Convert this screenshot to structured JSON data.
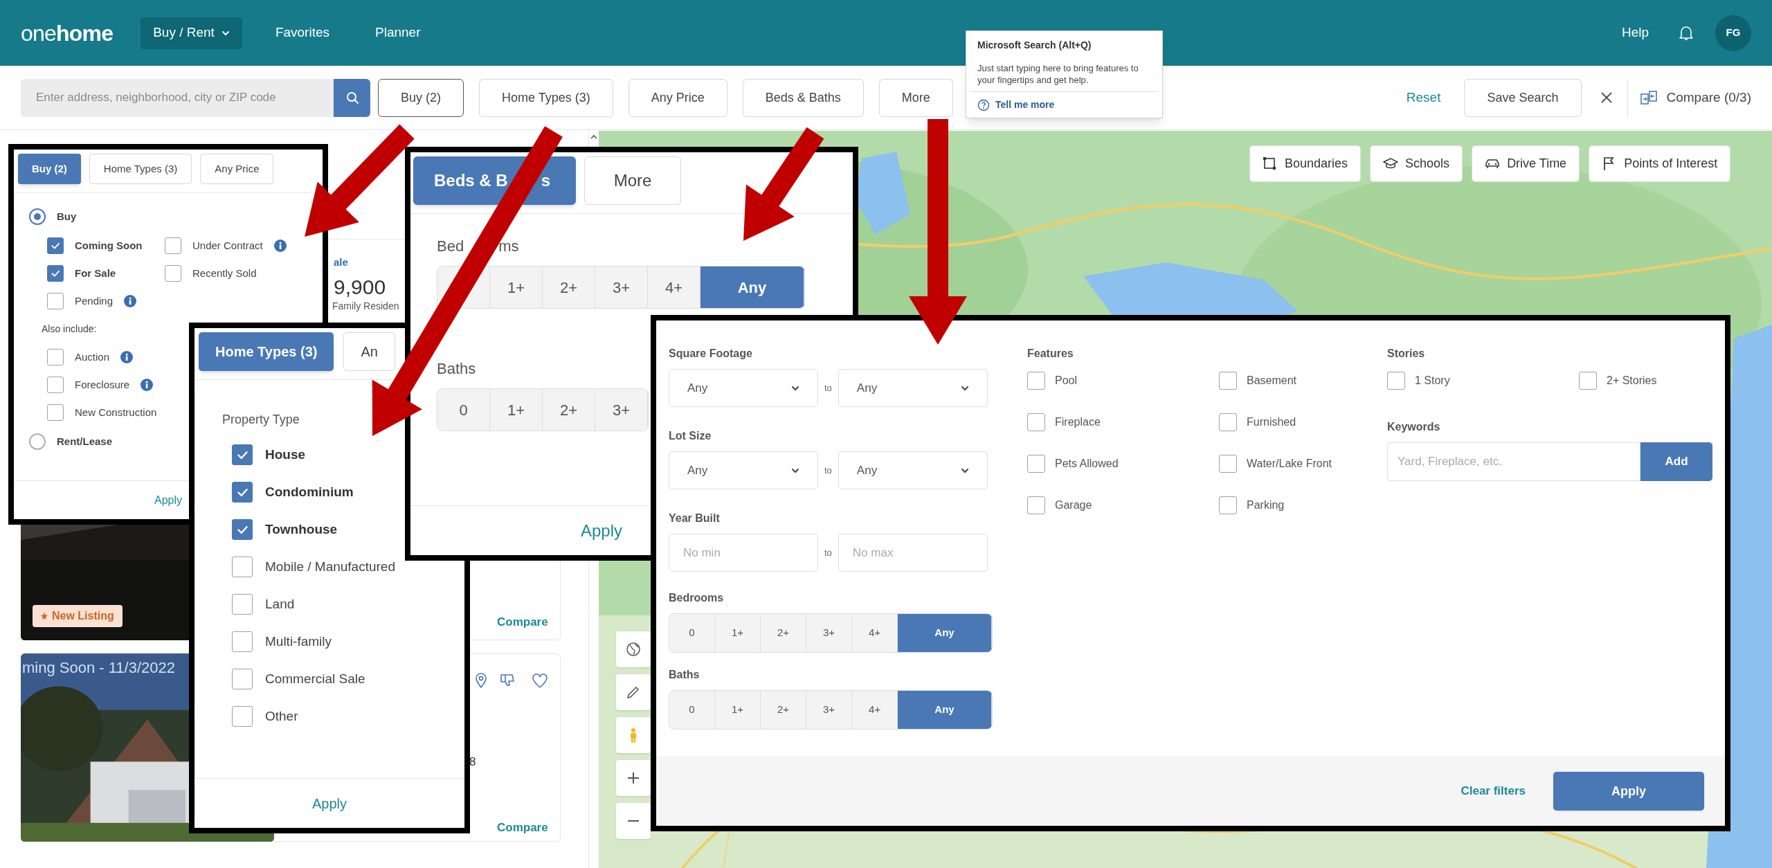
{
  "header": {
    "logo": "one**home**",
    "nav": [
      {
        "label": "Buy / Rent",
        "selected": true
      },
      {
        "label": "Favorites",
        "selected": false
      },
      {
        "label": "Planner",
        "selected": false
      }
    ],
    "help": "Help",
    "avatar": "FG"
  },
  "toolbar": {
    "search": {
      "placeholder": "Enter address, neighborhood, city or ZIP code"
    },
    "filters": [
      {
        "label": "Buy (2)",
        "selected": true
      },
      {
        "label": "Home Types (3)",
        "selected": false
      },
      {
        "label": "Any Price",
        "selected": false
      },
      {
        "label": "Beds & Baths",
        "selected": false
      },
      {
        "label": "More",
        "selected": false
      }
    ],
    "reset": "Reset",
    "save_search": "Save Search",
    "compare": "Compare (0/3)"
  },
  "tooltip": {
    "title": "Microsoft Search (Alt+Q)",
    "body": "Just start typing here to bring features to your fingertips and get help.",
    "link": "Tell me more"
  },
  "listings": [
    {
      "status": "ale",
      "price": "9,900",
      "type": "Family Residen",
      "badge": "New Listing",
      "compare": "Compare"
    },
    {
      "photo_label": "ming Soon - 11/3/2022",
      "detail": "8",
      "compare": "Compare"
    }
  ],
  "map": {
    "kind": "picture",
    "layers": [
      "Boundaries",
      "Schools",
      "Drive Time",
      "Points of Interest"
    ]
  },
  "buy_panel": {
    "tabs": [
      {
        "label": "Buy (2)",
        "selected": true
      },
      {
        "label": "Home Types (3)",
        "selected": false
      },
      {
        "label": "Any Price",
        "selected": false
      }
    ],
    "options": [
      {
        "label": "Buy",
        "selected": true,
        "statuses": [
          {
            "label": "Coming Soon",
            "checked": true,
            "info": false
          },
          {
            "label": "Under Contract",
            "checked": false,
            "info": true
          },
          {
            "label": "For Sale",
            "checked": true,
            "info": false
          },
          {
            "label": "Recently Sold",
            "checked": false,
            "info": false
          },
          {
            "label": "Pending",
            "checked": false,
            "info": true
          }
        ],
        "also_include": "Also include:",
        "extras": [
          {
            "label": "Auction",
            "checked": false,
            "info": true
          },
          {
            "label": "Foreclosure",
            "checked": false,
            "info": true
          },
          {
            "label": "New Construction",
            "checked": false,
            "info": false
          }
        ]
      },
      {
        "label": "Rent/Lease",
        "selected": false
      }
    ],
    "apply": "Apply"
  },
  "home_types_panel": {
    "tabs": [
      {
        "label": "Home Types (3)",
        "selected": true
      },
      {
        "label": "An",
        "selected": false
      }
    ],
    "heading": "Property Type",
    "types": [
      {
        "label": "House",
        "checked": true
      },
      {
        "label": "Condominium",
        "checked": true
      },
      {
        "label": "Townhouse",
        "checked": true
      },
      {
        "label": "Mobile / Manufactured",
        "checked": false
      },
      {
        "label": "Land",
        "checked": false
      },
      {
        "label": "Multi-family",
        "checked": false
      },
      {
        "label": "Commercial Sale",
        "checked": false
      },
      {
        "label": "Other",
        "checked": false
      }
    ],
    "apply": "Apply"
  },
  "beds_panel": {
    "tabs": [
      {
        "label_parts": [
          "Beds & B",
          "s"
        ],
        "selected": true
      },
      {
        "label_parts": [
          "More"
        ],
        "selected": false
      }
    ],
    "groups": [
      {
        "label_parts": [
          "Bed",
          "ms"
        ],
        "options": [
          {
            "selected": false
          },
          {
            "label": "1+",
            "selected": false
          },
          {
            "label": "2+",
            "selected": false
          },
          {
            "label": "3+",
            "selected": false
          },
          {
            "label": "4+",
            "selected": false
          },
          {
            "label": "Any",
            "selected": true
          }
        ]
      },
      {
        "label_parts": [
          "Baths"
        ],
        "options": [
          {
            "label": "0",
            "selected": false
          },
          {
            "label": "1+",
            "selected": false
          },
          {
            "label": "2+",
            "selected": false
          },
          {
            "label": "3+",
            "selected": false
          }
        ]
      }
    ],
    "apply": "Apply"
  },
  "more_panel": {
    "ranges": [
      {
        "label": "Square Footage",
        "kind": "select",
        "separator": "to",
        "fields": [
          {
            "value": "Any"
          },
          {
            "value": "Any"
          }
        ]
      },
      {
        "label": "Lot Size",
        "kind": "select",
        "separator": "to",
        "fields": [
          {
            "value": "Any"
          },
          {
            "value": "Any"
          }
        ]
      },
      {
        "label": "Year Built",
        "kind": "input",
        "separator": "to",
        "fields": [
          {
            "placeholder": "No min"
          },
          {
            "placeholder": "No max"
          }
        ]
      }
    ],
    "counts": [
      {
        "label": "Bedrooms",
        "options": [
          {
            "label": "0",
            "selected": false
          },
          {
            "label": "1+",
            "selected": false
          },
          {
            "label": "2+",
            "selected": false
          },
          {
            "label": "3+",
            "selected": false
          },
          {
            "label": "4+",
            "selected": false
          },
          {
            "label": "Any",
            "selected": true
          }
        ]
      },
      {
        "label": "Baths",
        "options": [
          {
            "label": "0",
            "selected": false
          },
          {
            "label": "1+",
            "selected": false
          },
          {
            "label": "2+",
            "selected": false
          },
          {
            "label": "3+",
            "selected": false
          },
          {
            "label": "4+",
            "selected": false
          },
          {
            "label": "Any",
            "selected": true
          }
        ]
      }
    ],
    "features": {
      "label": "Features",
      "items": [
        {
          "label": "Pool",
          "checked": false
        },
        {
          "label": "Basement",
          "checked": false
        },
        {
          "label": "Fireplace",
          "checked": false
        },
        {
          "label": "Furnished",
          "checked": false
        },
        {
          "label": "Pets Allowed",
          "checked": false
        },
        {
          "label": "Water/Lake Front",
          "checked": false
        },
        {
          "label": "Garage",
          "checked": false
        },
        {
          "label": "Parking",
          "checked": false
        }
      ]
    },
    "stories": {
      "label": "Stories",
      "items": [
        {
          "label": "1 Story",
          "checked": false
        },
        {
          "label": "2+ Stories",
          "checked": false
        }
      ]
    },
    "keywords": {
      "label": "Keywords",
      "placeholder": "Yard, Fireplace, etc.",
      "button": "Add"
    },
    "clear": "Clear filters",
    "apply": "Apply"
  }
}
